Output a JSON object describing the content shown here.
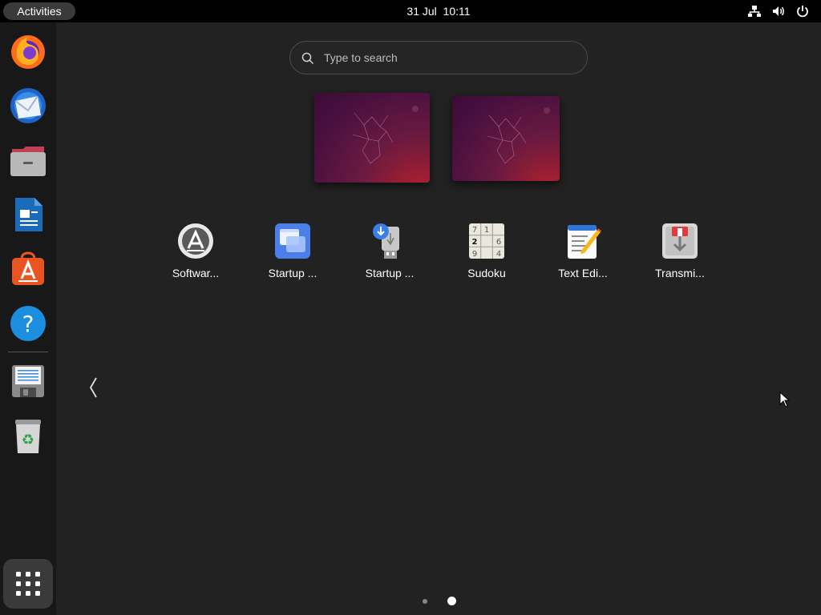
{
  "topbar": {
    "activities_label": "Activities",
    "clock": "31 Jul  10:11",
    "tray": [
      "network-icon",
      "volume-icon",
      "power-icon"
    ]
  },
  "dock": {
    "items": [
      {
        "name": "firefox",
        "icon": "firefox-icon"
      },
      {
        "name": "thunderbird",
        "icon": "thunderbird-icon"
      },
      {
        "name": "files",
        "icon": "files-icon"
      },
      {
        "name": "libreoffice-writer",
        "icon": "writer-icon"
      },
      {
        "name": "ubuntu-software",
        "icon": "software-store-icon"
      },
      {
        "name": "help",
        "icon": "help-icon"
      },
      {
        "name": "disk-image",
        "icon": "floppy-icon"
      },
      {
        "name": "trash",
        "icon": "trash-icon"
      }
    ],
    "show_apps_icon": "app-grid-icon"
  },
  "search": {
    "placeholder": "Type to search",
    "value": ""
  },
  "workspaces": {
    "count": 2
  },
  "apps": [
    {
      "label": "Softwar...",
      "icon": "software-updater-icon"
    },
    {
      "label": "Startup ...",
      "icon": "startup-applications-icon"
    },
    {
      "label": "Startup ...",
      "icon": "startup-disk-creator-icon"
    },
    {
      "label": "Sudoku",
      "icon": "sudoku-icon"
    },
    {
      "label": "Text Edi...",
      "icon": "text-editor-icon"
    },
    {
      "label": "Transmi...",
      "icon": "transmission-icon"
    }
  ],
  "pagination": {
    "pages": 2,
    "current": 2
  },
  "colors": {
    "background": "#222222",
    "topbar": "#000000",
    "dock": "#181818",
    "accent": "#e95420"
  }
}
